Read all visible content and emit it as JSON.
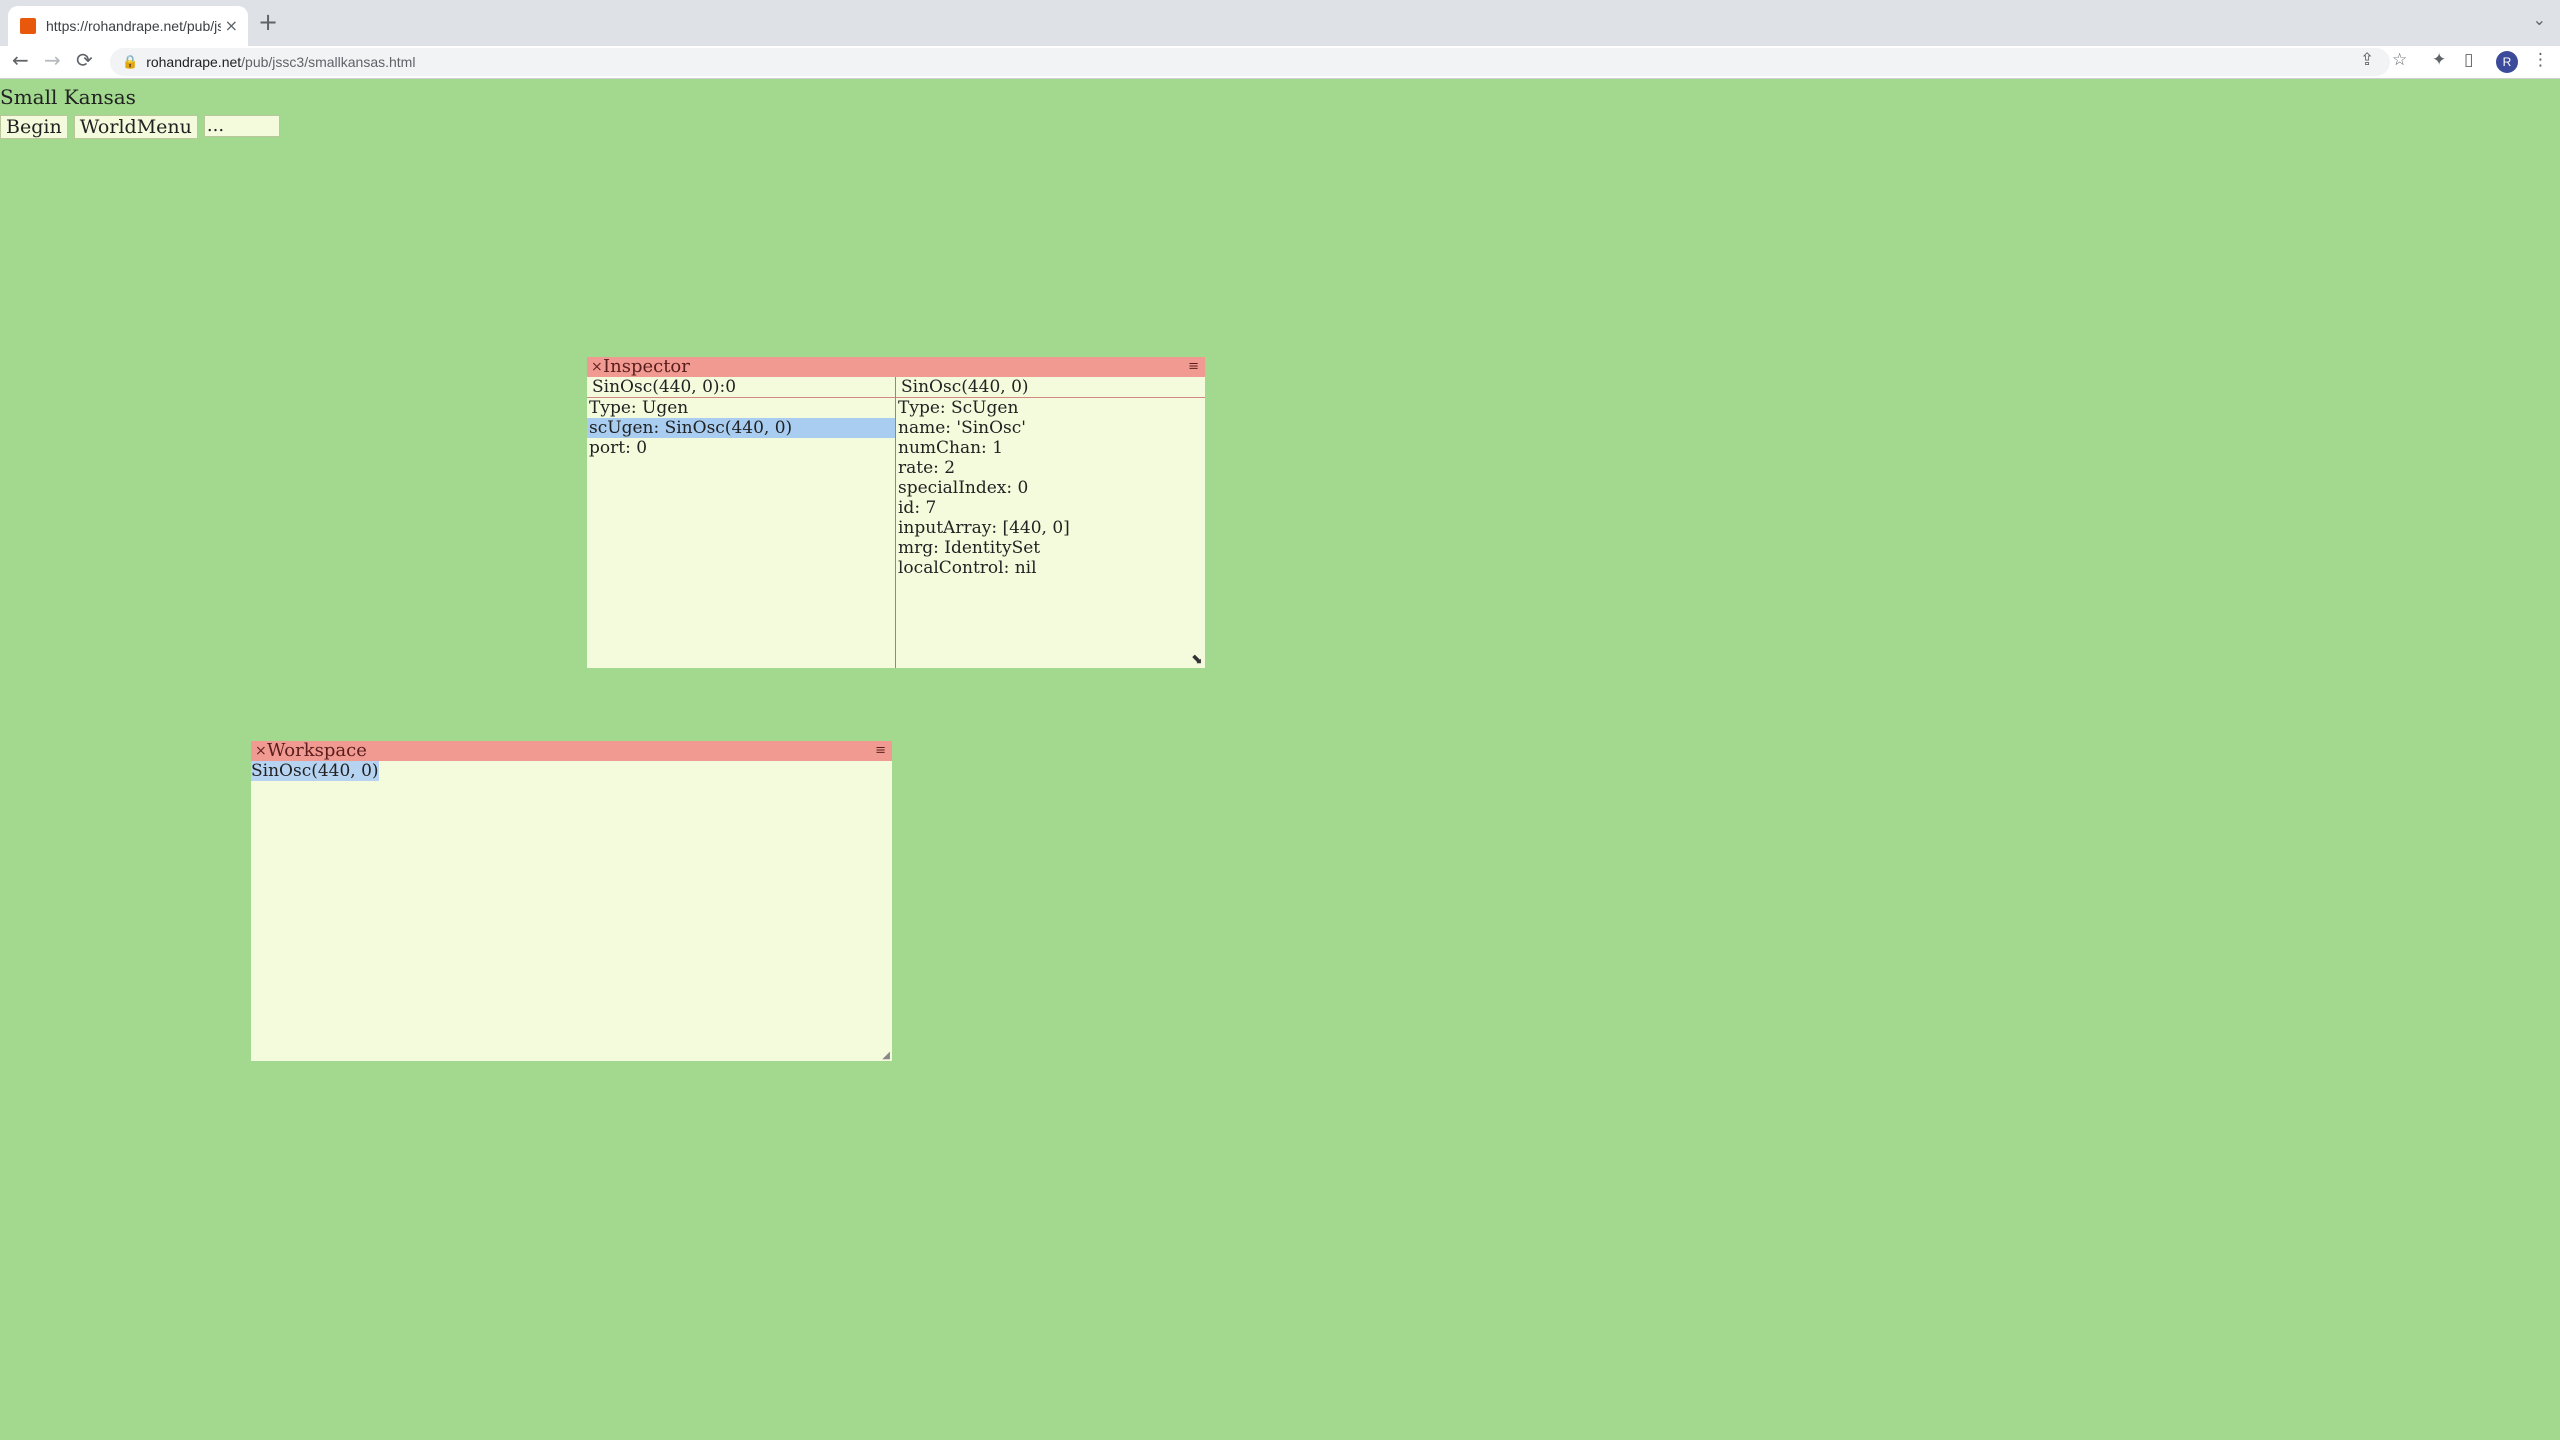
{
  "browser": {
    "tab_title": "https://rohandrape.net/pub/jssc3/smallkansas.html",
    "tab_close": "×",
    "new_tab": "+",
    "tab_overflow": "⌄",
    "url_host": "rohandrape.net",
    "url_path": "/pub/jssc3/smallkansas.html",
    "back": "←",
    "forward": "→",
    "reload": "⟳",
    "lock": "🔒",
    "share": "⇪",
    "star": "☆",
    "extensions": "✦",
    "sidepanel": "▯",
    "avatar_letter": "R",
    "menu": "⋮"
  },
  "page": {
    "title": "Small Kansas",
    "buttons": [
      "Begin",
      "WorldMenu"
    ],
    "input_value": "..."
  },
  "inspector": {
    "title": "Inspector",
    "close": "×",
    "menu": "≡",
    "left_header": "SinOsc(440, 0):0",
    "left_items": [
      "Type: Ugen",
      "scUgen: SinOsc(440, 0)",
      "port: 0"
    ],
    "right_header": "SinOsc(440, 0)",
    "right_items": [
      "Type: ScUgen",
      "name: 'SinOsc'",
      "numChan: 1",
      "rate: 2",
      "specialIndex: 0",
      "id: 7",
      "inputArray: [440, 0]",
      "mrg: IdentitySet",
      "localControl: nil"
    ],
    "resize_grip": "⬊"
  },
  "workspace": {
    "title": "Workspace",
    "close": "×",
    "menu": "≡",
    "text": "SinOsc(440, 0)",
    "resize_grip": "◢"
  },
  "colors": {
    "page_bg": "#a2d98e",
    "titlebar": "#f09a91",
    "window_bg": "#f4fadc",
    "selection": "#a8cdf0"
  }
}
